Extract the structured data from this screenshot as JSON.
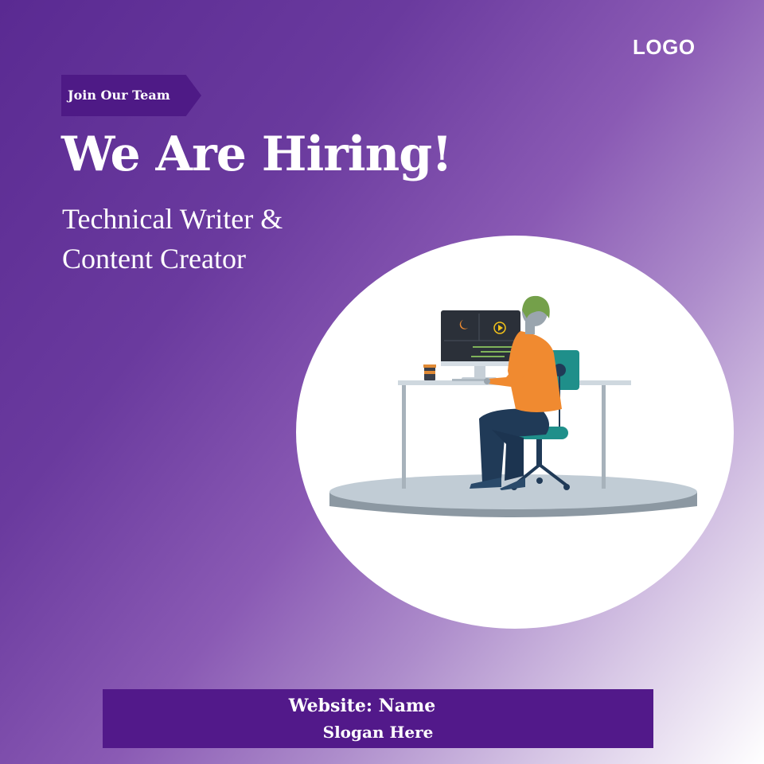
{
  "brand": {
    "logo_text": "LOGO"
  },
  "ribbon": {
    "label": "Join Our Team"
  },
  "headline": {
    "title": "We Are Hiring!"
  },
  "position": {
    "line1": "Technical Writer &",
    "line2": "Content Creator"
  },
  "footer": {
    "website": "Website: Name",
    "slogan": "Slogan Here"
  },
  "illustration": {
    "icon": "person-at-desk-illustration"
  },
  "colors": {
    "primary_purple": "#52198a",
    "gradient_start": "#5a2a92",
    "gradient_end": "#ffffff",
    "accent_orange": "#f08a30",
    "accent_teal": "#1f8f8a"
  }
}
